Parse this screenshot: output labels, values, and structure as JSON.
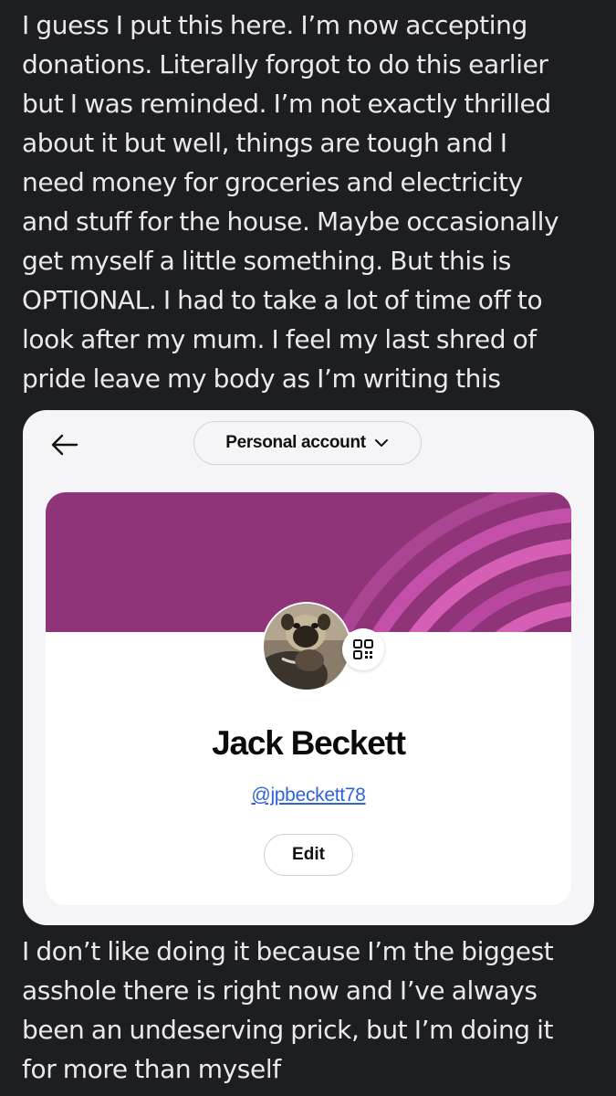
{
  "post": {
    "text_top_lines": [
      "I guess I put this here. I’m now accepting",
      "donations. Literally forgot to do this earlier",
      "but I was reminded. I’m not exactly thrilled",
      "about it but well, things are tough and I",
      "need money for groceries and electricity",
      "and stuff for the house. Maybe occasionally",
      "get myself a little something. But this is",
      "OPTIONAL. I had to take a lot of time off to",
      "look after my mum. I feel my last shred of",
      "pride leave my body as I’m writing this"
    ],
    "text_bottom_lines": [
      "I don’t like doing it because I’m the biggest",
      "asshole there is right now and I’ve always",
      "been an undeserving prick, but I’m doing it",
      "for more than myself"
    ]
  },
  "embedded_screenshot": {
    "back_icon": "arrow-left-icon",
    "account_selector": {
      "label": "Personal account",
      "icon": "chevron-down-icon"
    },
    "profile": {
      "name": "Jack Beckett",
      "handle": "@jpbeckett78",
      "edit_label": "Edit",
      "avatar_icon": "pug-avatar",
      "qr_icon": "qr-code-icon",
      "banner_color": "#8f3479",
      "banner_accent": "#d65fb6"
    }
  },
  "colors": {
    "background": "#1d1e22",
    "text": "#e9e9ea",
    "card": "#f5f5f8",
    "handle_link": "#2f62d8"
  }
}
